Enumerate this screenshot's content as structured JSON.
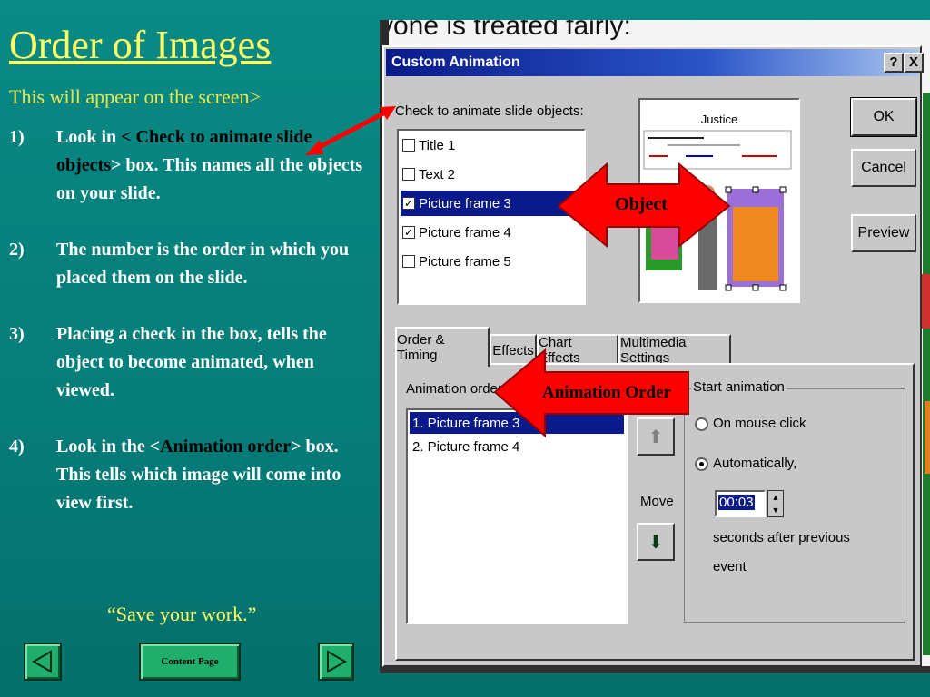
{
  "slide": {
    "title": "Order of Images",
    "subtitle": "This will appear on the screen>",
    "steps": [
      {
        "num": "1)",
        "pre": "Look in ",
        "hl": "< Check to animate slide objects",
        "post": "> box.  This names all the objects on your slide."
      },
      {
        "num": "2)",
        "pre": "The number is the order in which you placed them on the slide.",
        "hl": "",
        "post": ""
      },
      {
        "num": "3)",
        "pre": "Placing a check in the box, tells the object to become animated, when viewed.",
        "hl": "",
        "post": ""
      },
      {
        "num": "4)",
        "pre": "Look in the <",
        "hl": "Animation order",
        "post": "> box.  This tells which image will come into view first."
      }
    ],
    "save_note": "“Save your work.”",
    "nav": {
      "content_label": "Content Page"
    }
  },
  "background": {
    "text": "yone is treated fairly:"
  },
  "dialog": {
    "title": "Custom Animation",
    "help": "?",
    "close": "X",
    "check_label": "Check to animate slide objects:",
    "objects": [
      {
        "label": "Title 1",
        "checked": ""
      },
      {
        "label": "Text 2",
        "checked": ""
      },
      {
        "label": "Picture frame 3",
        "checked": "✓"
      },
      {
        "label": "Picture frame 4",
        "checked": "✓"
      },
      {
        "label": "Picture frame 5",
        "checked": ""
      }
    ],
    "preview": {
      "heading": "Justice"
    },
    "buttons": {
      "ok": "OK",
      "cancel": "Cancel",
      "preview": "Preview"
    },
    "tabs": [
      "Order & Timing",
      "Effects",
      "Chart Effects",
      "Multimedia Settings"
    ],
    "animation_order_label": "Animation order:",
    "animation_order": [
      "1. Picture frame 3",
      "2. Picture frame 4"
    ],
    "move_label": "Move",
    "start_animation": {
      "title": "Start animation",
      "on_mouse_click": "On mouse click",
      "automatically": "Automatically,",
      "time": "00:03",
      "seconds_label": "seconds after previous",
      "event_label": "event"
    }
  },
  "overlays": {
    "object_label": "Object",
    "animation_order_label": "Animation Order"
  },
  "colors": {
    "background": "#0a8a85",
    "title": "#ffff66",
    "arrow": "#ff0000",
    "highlight": "#0a1a8a"
  }
}
